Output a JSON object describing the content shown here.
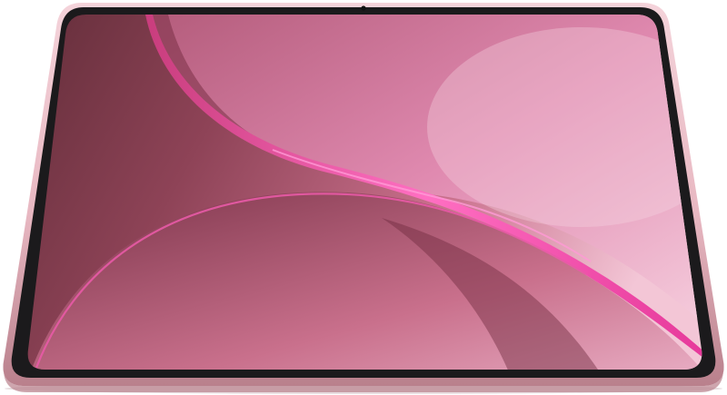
{
  "device": {
    "frame_color": "#e8b8c2",
    "frame_shadow_color": "#b9808c",
    "bezel_color": "#1b1a1c",
    "camera_color": "#111111"
  },
  "wallpaper": {
    "base_color": "#c9708c",
    "dark_color": "#5e2b36",
    "light_color": "#f3c6d6",
    "accent_color": "#e6389a",
    "highlight_color": "#ff6fc2"
  }
}
